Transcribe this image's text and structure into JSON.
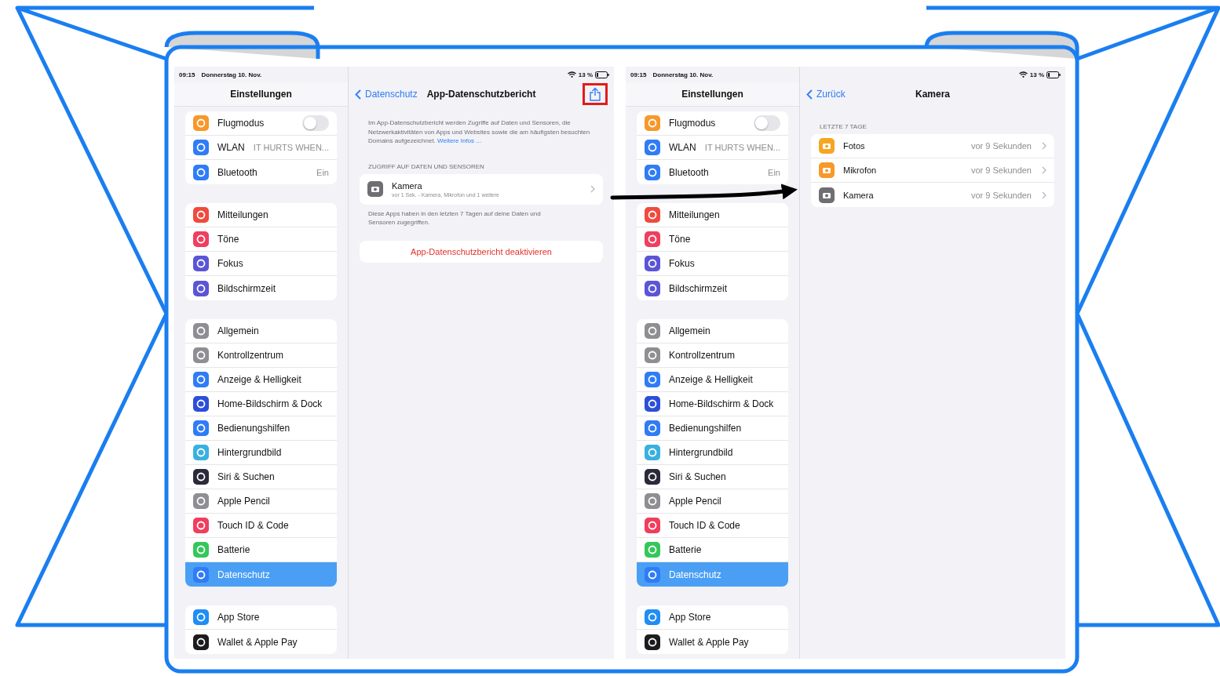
{
  "screens": [
    {
      "status": {
        "time": "09:15",
        "date": "Donnerstag 10. Nov.",
        "battery": "13 %"
      },
      "sidebar": {
        "title": "Einstellungen",
        "groups": [
          {
            "items": [
              {
                "label": "Flugmodus",
                "color": "#f7982b",
                "kind": "toggle",
                "on": false,
                "selected": false
              },
              {
                "label": "WLAN",
                "color": "#2f7cf6",
                "kind": "value",
                "value": "IT HURTS WHEN...",
                "selected": false
              },
              {
                "label": "Bluetooth",
                "color": "#2f7cf6",
                "kind": "value",
                "value": "Ein",
                "selected": false
              }
            ]
          },
          {
            "items": [
              {
                "label": "Mitteilungen",
                "color": "#f04a3e",
                "kind": "link",
                "selected": false
              },
              {
                "label": "Töne",
                "color": "#f03e5e",
                "kind": "link",
                "selected": false
              },
              {
                "label": "Fokus",
                "color": "#5b55d6",
                "kind": "link",
                "selected": false
              },
              {
                "label": "Bildschirmzeit",
                "color": "#5b55d6",
                "kind": "link",
                "selected": false
              }
            ]
          },
          {
            "items": [
              {
                "label": "Allgemein",
                "color": "#8e8e93",
                "kind": "link",
                "selected": false
              },
              {
                "label": "Kontrollzentrum",
                "color": "#8e8e93",
                "kind": "link",
                "selected": false
              },
              {
                "label": "Anzeige & Helligkeit",
                "color": "#2f7cf6",
                "kind": "link",
                "selected": false
              },
              {
                "label": "Home-Bildschirm & Dock",
                "color": "#2c4fd8",
                "kind": "link",
                "selected": false
              },
              {
                "label": "Bedienungshilfen",
                "color": "#2f7cf6",
                "kind": "link",
                "selected": false
              },
              {
                "label": "Hintergrundbild",
                "color": "#3ab0e0",
                "kind": "link",
                "selected": false
              },
              {
                "label": "Siri & Suchen",
                "color": "#2a2a3a",
                "kind": "link",
                "selected": false
              },
              {
                "label": "Apple Pencil",
                "color": "#8e8e93",
                "kind": "link",
                "selected": false
              },
              {
                "label": "Touch ID & Code",
                "color": "#f03e5e",
                "kind": "link",
                "selected": false
              },
              {
                "label": "Batterie",
                "color": "#34c759",
                "kind": "link",
                "selected": false
              },
              {
                "label": "Datenschutz",
                "color": "#2f7cf6",
                "kind": "link",
                "selected": true
              }
            ]
          },
          {
            "items": [
              {
                "label": "App Store",
                "color": "#1f8ef5",
                "kind": "link",
                "selected": false
              },
              {
                "label": "Wallet & Apple Pay",
                "color": "#1c1c1e",
                "kind": "link",
                "selected": false
              }
            ]
          }
        ]
      },
      "detail": {
        "back": "Datenschutz",
        "title": "App-Datenschutzbericht",
        "share": {
          "highlighted": true
        },
        "intro": {
          "text": "Im App-Datenschutzbericht werden Zugriffe auf Daten und Sensoren, die Netzwerkaktivitäten von Apps und Websites sowie die am häufigsten besuchten Domains aufgezeichnet.",
          "link": "Weitere Infos ..."
        },
        "sections": [
          {
            "header": "ZUGRIFF AUF DATEN UND SENSOREN",
            "rows": [
              {
                "title": "Kamera",
                "subtitle": "vor 1 Sek. - Kamera, Mikrofon und 1 weitere",
                "color": "#6e6e73"
              }
            ],
            "footer": "Diese Apps haben in den letzten 7 Tagen auf deine Daten und Sensoren zugegriffen."
          }
        ],
        "action": "App-Datenschutzbericht deaktivieren"
      }
    },
    {
      "status": {
        "time": "09:15",
        "date": "Donnerstag 10. Nov.",
        "battery": "13 %"
      },
      "sidebar": {
        "title": "Einstellungen",
        "groups": [
          {
            "items": [
              {
                "label": "Flugmodus",
                "color": "#f7982b",
                "kind": "toggle",
                "on": false,
                "selected": false
              },
              {
                "label": "WLAN",
                "color": "#2f7cf6",
                "kind": "value",
                "value": "IT HURTS WHEN...",
                "selected": false
              },
              {
                "label": "Bluetooth",
                "color": "#2f7cf6",
                "kind": "value",
                "value": "Ein",
                "selected": false
              }
            ]
          },
          {
            "items": [
              {
                "label": "Mitteilungen",
                "color": "#f04a3e",
                "kind": "link",
                "selected": false
              },
              {
                "label": "Töne",
                "color": "#f03e5e",
                "kind": "link",
                "selected": false
              },
              {
                "label": "Fokus",
                "color": "#5b55d6",
                "kind": "link",
                "selected": false
              },
              {
                "label": "Bildschirmzeit",
                "color": "#5b55d6",
                "kind": "link",
                "selected": false
              }
            ]
          },
          {
            "items": [
              {
                "label": "Allgemein",
                "color": "#8e8e93",
                "kind": "link",
                "selected": false
              },
              {
                "label": "Kontrollzentrum",
                "color": "#8e8e93",
                "kind": "link",
                "selected": false
              },
              {
                "label": "Anzeige & Helligkeit",
                "color": "#2f7cf6",
                "kind": "link",
                "selected": false
              },
              {
                "label": "Home-Bildschirm & Dock",
                "color": "#2c4fd8",
                "kind": "link",
                "selected": false
              },
              {
                "label": "Bedienungshilfen",
                "color": "#2f7cf6",
                "kind": "link",
                "selected": false
              },
              {
                "label": "Hintergrundbild",
                "color": "#3ab0e0",
                "kind": "link",
                "selected": false
              },
              {
                "label": "Siri & Suchen",
                "color": "#2a2a3a",
                "kind": "link",
                "selected": false
              },
              {
                "label": "Apple Pencil",
                "color": "#8e8e93",
                "kind": "link",
                "selected": false
              },
              {
                "label": "Touch ID & Code",
                "color": "#f03e5e",
                "kind": "link",
                "selected": false
              },
              {
                "label": "Batterie",
                "color": "#34c759",
                "kind": "link",
                "selected": false
              },
              {
                "label": "Datenschutz",
                "color": "#2f7cf6",
                "kind": "link",
                "selected": true
              }
            ]
          },
          {
            "items": [
              {
                "label": "App Store",
                "color": "#1f8ef5",
                "kind": "link",
                "selected": false
              },
              {
                "label": "Wallet & Apple Pay",
                "color": "#1c1c1e",
                "kind": "link",
                "selected": false
              }
            ]
          }
        ]
      },
      "detail": {
        "back": "Zurück",
        "title": "Kamera",
        "sections": [
          {
            "header": "LETZTE 7 TAGE",
            "rows": [
              {
                "title": "Fotos",
                "value": "vor 9 Sekunden",
                "color": "#f5a623"
              },
              {
                "title": "Mikrofon",
                "value": "vor 9 Sekunden",
                "color": "#f7982b"
              },
              {
                "title": "Kamera",
                "value": "vor 9 Sekunden",
                "color": "#6e6e73"
              }
            ]
          }
        ]
      }
    }
  ]
}
